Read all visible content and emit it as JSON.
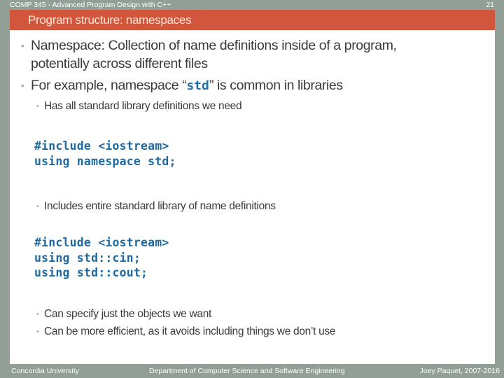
{
  "header": {
    "course": "COMP 345 - Advanced Program Design with C++",
    "slide_number": "21"
  },
  "title": "Program structure: namespaces",
  "body": {
    "bullet1": {
      "line1": "Namespace: Collection of name definitions inside of a program,",
      "line2": "potentially across different files"
    },
    "bullet2": {
      "prefix": "For example, namespace “",
      "code": "std",
      "suffix": "” is common in libraries"
    },
    "sub1": "Has all standard library definitions we need",
    "code1": [
      "#include <iostream>",
      "using namespace std;"
    ],
    "sub2": "Includes entire standard library of name definitions",
    "code2": [
      "#include <iostream>",
      "using std::cin;",
      "using std::cout;"
    ],
    "sub3": "Can specify just the objects we want",
    "sub4": "Can be more efficient, as it avoids including things we don’t use",
    "bullet_glyph": "•"
  },
  "footer": {
    "left": "Concordia University",
    "center": "Department of Computer Science and Software Engineering",
    "right": "Joey Paquet, 2007-2016"
  },
  "colors": {
    "frame": "#919f97",
    "title_bar": "#d2563c",
    "title_text": "#fbe7d8",
    "code": "#1e6aa1",
    "body_text": "#3a3a3a"
  }
}
